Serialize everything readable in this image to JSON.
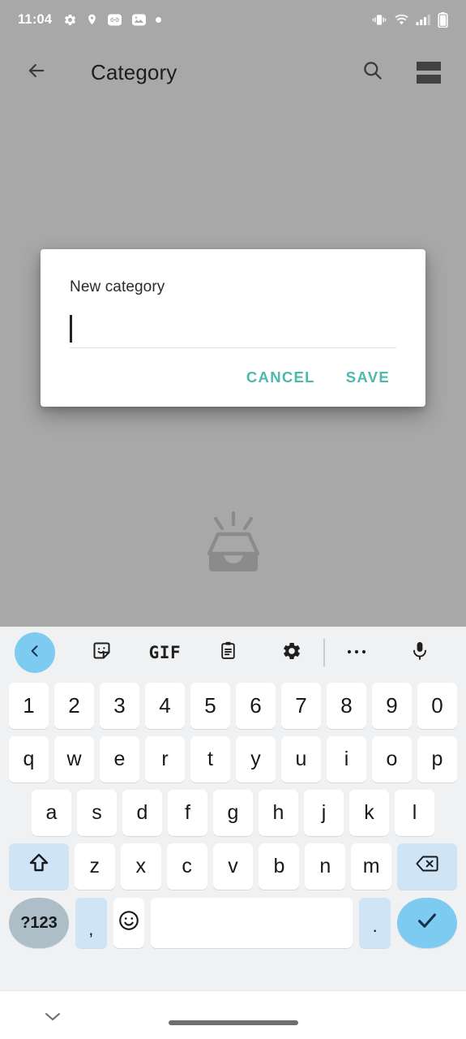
{
  "status_bar": {
    "time": "11:04",
    "left_icons": [
      "gear-icon",
      "location-pin-icon",
      "link-badge-icon",
      "photo-badge-icon",
      "dot-icon"
    ],
    "right_icons": [
      "vibrate-icon",
      "wifi-icon",
      "cellular-signal-icon",
      "battery-icon"
    ]
  },
  "app_bar": {
    "back_icon": "back-arrow-icon",
    "title": "Category",
    "search_icon": "search-icon",
    "menu_icon": "list-view-icon"
  },
  "empty_state": {
    "icon": "empty-inbox-icon"
  },
  "dialog": {
    "label": "New category",
    "input_value": "",
    "input_placeholder": "",
    "cancel_label": "CANCEL",
    "save_label": "SAVE"
  },
  "keyboard": {
    "toolbar": [
      {
        "name": "keyboard-back-button",
        "icon": "chevron-left-icon",
        "label": ""
      },
      {
        "name": "sticker-button",
        "icon": "sticker-icon",
        "label": ""
      },
      {
        "name": "gif-button",
        "icon": "gif-icon",
        "label": "GIF"
      },
      {
        "name": "clipboard-button",
        "icon": "clipboard-icon",
        "label": ""
      },
      {
        "name": "keyboard-settings-button",
        "icon": "gear-icon",
        "label": ""
      },
      {
        "name": "more-options-button",
        "icon": "overflow-dots-icon",
        "label": ""
      },
      {
        "name": "voice-input-button",
        "icon": "microphone-icon",
        "label": ""
      }
    ],
    "rows": {
      "numbers": [
        "1",
        "2",
        "3",
        "4",
        "5",
        "6",
        "7",
        "8",
        "9",
        "0"
      ],
      "top": [
        "q",
        "w",
        "e",
        "r",
        "t",
        "y",
        "u",
        "i",
        "o",
        "p"
      ],
      "home": [
        "a",
        "s",
        "d",
        "f",
        "g",
        "h",
        "j",
        "k",
        "l"
      ],
      "bottom": [
        "z",
        "x",
        "c",
        "v",
        "b",
        "n",
        "m"
      ]
    },
    "shift_icon": "shift-icon",
    "backspace_icon": "backspace-icon",
    "symbols_label": "?123",
    "comma_label": ",",
    "emoji_icon": "emoji-icon",
    "space_label": "",
    "period_label": ".",
    "enter_icon": "checkmark-icon"
  },
  "nav_bar": {
    "hide_keyboard_icon": "chevron-down-icon",
    "home_indicator": "home-gesture-bar"
  },
  "colors": {
    "scrim": "#a8a8a8",
    "dialog_bg": "#ffffff",
    "accent_teal": "#4db8ad",
    "keyboard_bg": "#eff1f3",
    "key_bg": "#ffffff",
    "mod_key_bg": "#cfe4f5",
    "accent_blue": "#7ecbf2",
    "numpad_key_bg": "#aebec9"
  }
}
